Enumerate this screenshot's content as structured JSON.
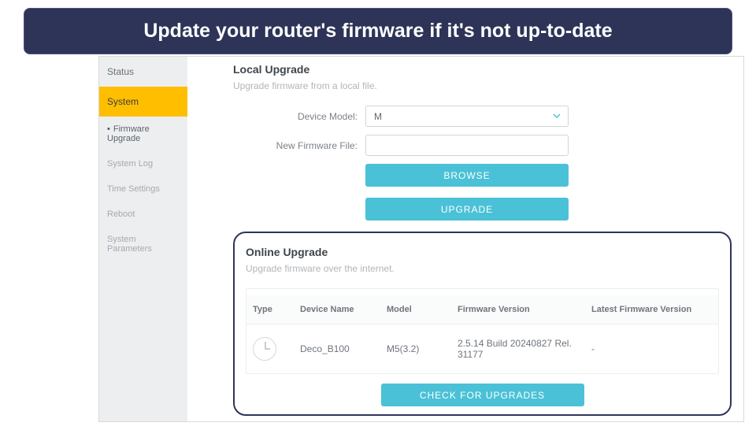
{
  "banner": "Update your router's firmware if it's not up-to-date",
  "sidebar": {
    "status": "Status",
    "system": "System",
    "items": [
      "Firmware Upgrade",
      "System Log",
      "Time Settings",
      "Reboot",
      "System Parameters"
    ]
  },
  "local": {
    "title": "Local Upgrade",
    "sub": "Upgrade firmware from a local file.",
    "device_model_label": "Device Model:",
    "device_model_value": "M",
    "new_file_label": "New Firmware File:",
    "new_file_value": "",
    "browse": "BROWSE",
    "upgrade": "UPGRADE"
  },
  "online": {
    "title": "Online Upgrade",
    "sub": "Upgrade firmware over the internet.",
    "headers": {
      "type": "Type",
      "device_name": "Device Name",
      "model": "Model",
      "firmware": "Firmware Version",
      "latest": "Latest Firmware Version"
    },
    "row": {
      "device_name": "Deco_B100",
      "model": "M5(3.2)",
      "firmware": "2.5.14 Build 20240827 Rel. 31177",
      "latest": "-"
    },
    "check": "CHECK FOR UPGRADES"
  }
}
